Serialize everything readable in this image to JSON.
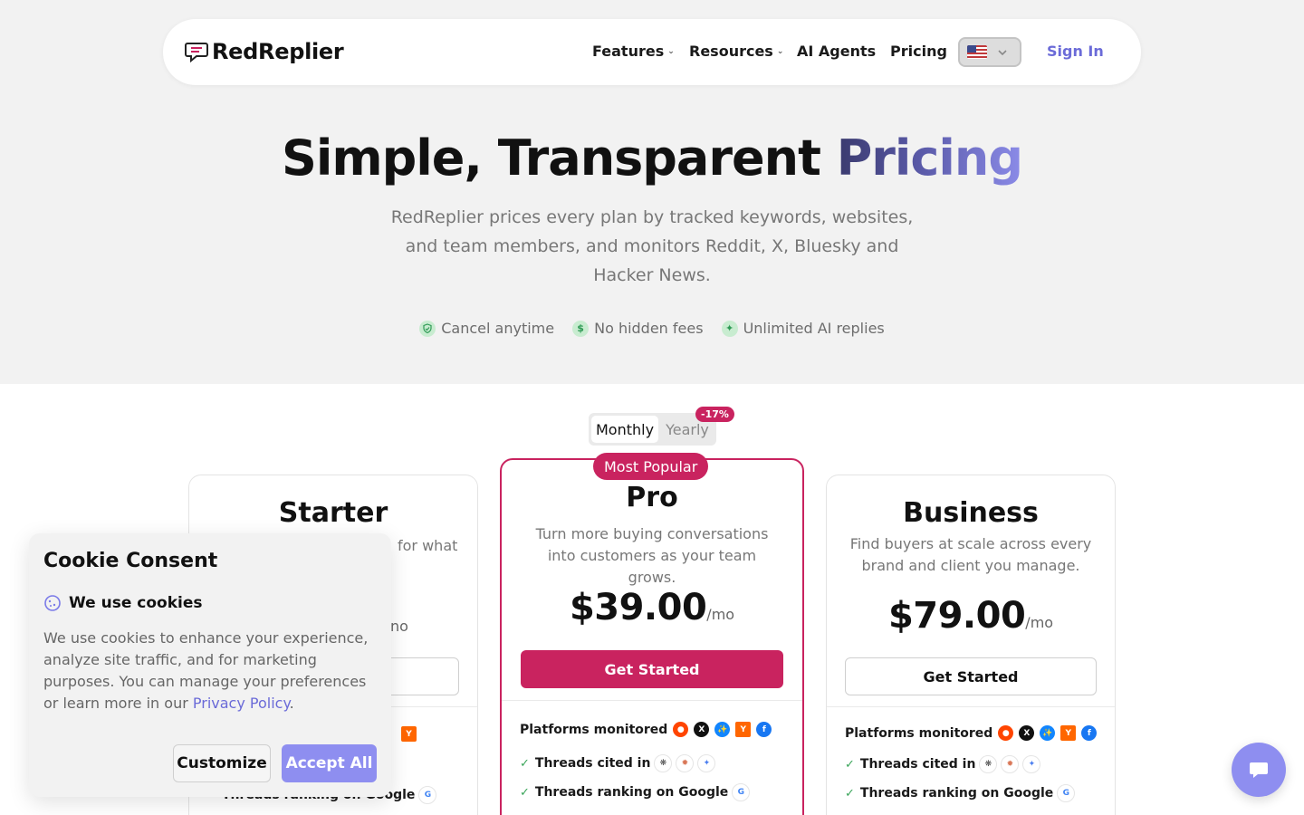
{
  "nav": {
    "logo_text": "RedReplier",
    "items": [
      {
        "label": "Features",
        "has_dropdown": true
      },
      {
        "label": "Resources",
        "has_dropdown": true
      },
      {
        "label": "AI Agents",
        "has_dropdown": false
      },
      {
        "label": "Pricing",
        "has_dropdown": false
      }
    ],
    "language": {
      "icon": "us-flag-icon"
    },
    "signin_label": "Sign In"
  },
  "hero": {
    "title_plain": "Simple, Transparent ",
    "title_accent": "Pricing",
    "subtitle": "RedReplier prices every plan by tracked keywords, websites, and team members, and monitors Reddit, X, Bluesky and Hacker News.",
    "perks": [
      {
        "icon": "shield-check-icon",
        "label": "Cancel anytime"
      },
      {
        "icon": "dollar-icon",
        "label": "No hidden fees"
      },
      {
        "icon": "sparkle-icon",
        "label": "Unlimited AI replies"
      }
    ]
  },
  "billing_toggle": {
    "monthly_label": "Monthly",
    "yearly_label": "Yearly",
    "selected": "Monthly",
    "discount_badge": "-17%"
  },
  "plans": {
    "starter": {
      "name": "Starter",
      "desc_visible_fragment": "for what",
      "price_per_fragment": "no",
      "features": {
        "ranking_label_fragment": "Threads ranking on Google"
      }
    },
    "pro": {
      "badge": "Most Popular",
      "name": "Pro",
      "description": "Turn more buying conversations into customers as your team grows.",
      "price": "$39.00",
      "per": "/mo",
      "cta": "Get Started",
      "features": {
        "platforms_label": "Platforms monitored",
        "cited_label": "Threads cited in",
        "ranking_label": "Threads ranking on Google"
      }
    },
    "business": {
      "name": "Business",
      "description": "Find buyers at scale across every brand and client you manage.",
      "price": "$79.00",
      "per": "/mo",
      "cta": "Get Started",
      "features": {
        "platforms_label": "Platforms monitored",
        "cited_label": "Threads cited in",
        "ranking_label": "Threads ranking on Google"
      }
    },
    "platform_icons": [
      "reddit-icon",
      "x-icon",
      "bluesky-icon",
      "hacker-news-icon",
      "facebook-icon"
    ],
    "cited_icons": [
      "chatgpt-icon",
      "claude-icon",
      "gemini-icon"
    ],
    "ranking_icons": [
      "google-icon"
    ]
  },
  "cookie": {
    "title": "Cookie Consent",
    "subtitle": "We use cookies",
    "text": "We use cookies to enhance your experience, analyze site traffic, and for marketing purposes. You can manage your preferences or learn more in our ",
    "link_label": "Privacy Policy",
    "text_end": ".",
    "customize_label": "Customize",
    "accept_label": "Accept All"
  },
  "chat": {
    "icon": "chat-bubble-icon"
  },
  "colors": {
    "brand": "#c9235f",
    "accent": "#8e8ef0",
    "link": "#6b6bd8",
    "hero_bg": "#f2f2f2"
  }
}
